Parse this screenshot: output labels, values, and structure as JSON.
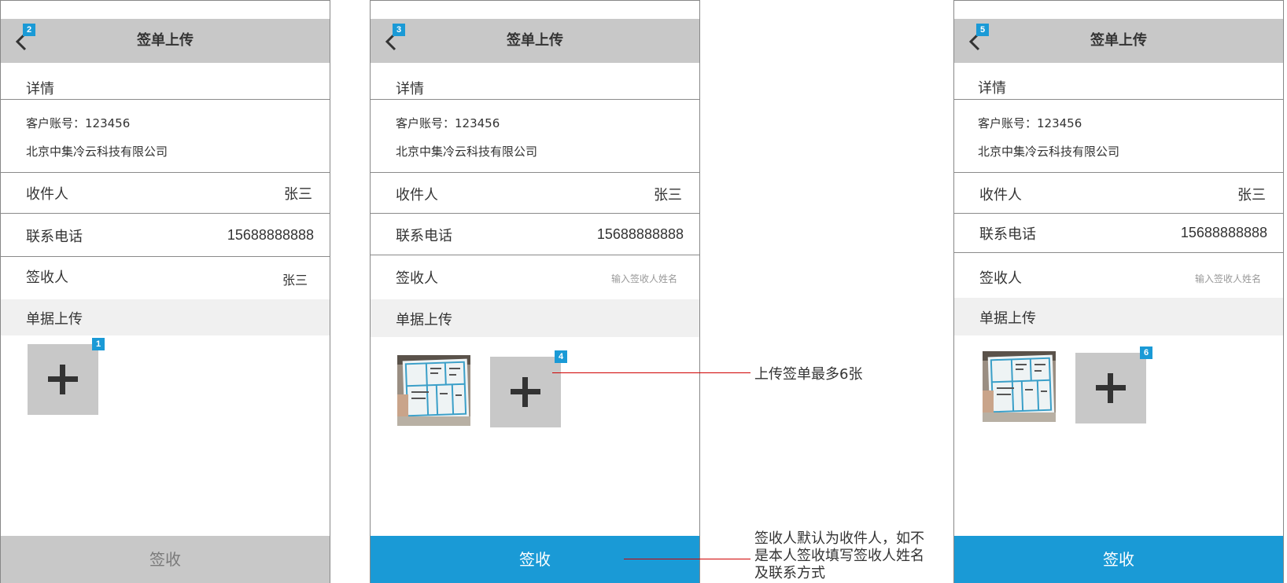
{
  "screens": [
    {
      "title": "签单上传",
      "badge": "2",
      "detail": "详情",
      "account": "客户账号：123456",
      "company": "北京中集冷云科技有限公司",
      "receiver_label": "收件人",
      "receiver_value": "张三",
      "phone_label": "联系电话",
      "phone_value": "15688888888",
      "signer_label": "签收人",
      "signer_value": "张三",
      "upload_label": "单据上传",
      "add_badge": "1",
      "submit_label": "签收"
    },
    {
      "title": "签单上传",
      "badge": "3",
      "detail": "详情",
      "account": "客户账号：123456",
      "company": "北京中集冷云科技有限公司",
      "receiver_label": "收件人",
      "receiver_value": "张三",
      "phone_label": "联系电话",
      "phone_value": "15688888888",
      "signer_label": "签收人",
      "signer_placeholder": "输入签收人姓名",
      "upload_label": "单据上传",
      "add_badge": "4",
      "submit_label": "签收"
    },
    {
      "title": "签单上传",
      "badge": "5",
      "detail": "详情",
      "account": "客户账号：123456",
      "company": "北京中集冷云科技有限公司",
      "receiver_label": "收件人",
      "receiver_value": "张三",
      "phone_label": "联系电话",
      "phone_value": "15688888888",
      "signer_label": "签收人",
      "signer_placeholder": "输入签收人姓名",
      "upload_label": "单据上传",
      "add_badge": "6",
      "submit_label": "签收"
    }
  ],
  "annotations": {
    "max_upload": "上传签单最多6张",
    "signer_note_line1": "签收人默认为收件人，如不",
    "signer_note_line2": "是本人签收填写签收人姓名",
    "signer_note_line3": "及联系方式"
  },
  "colors": {
    "accent": "#1a9ad6",
    "header_gray": "#c8c8c8",
    "band_gray": "#f0f0f0",
    "annotation_red": "#d00000"
  },
  "icons": [
    "back-arrow-icon",
    "plus-icon"
  ]
}
